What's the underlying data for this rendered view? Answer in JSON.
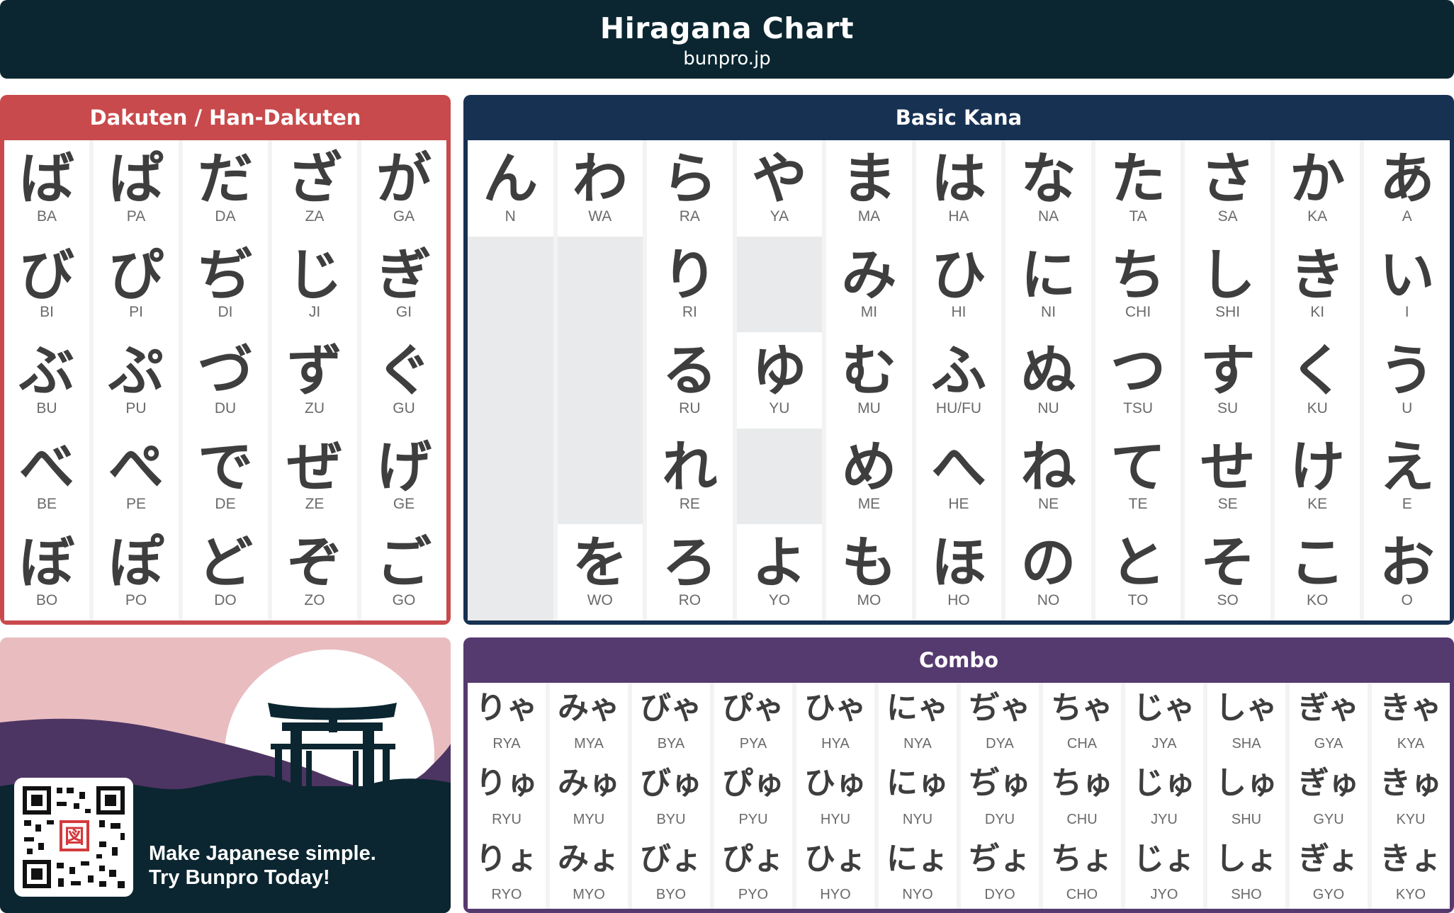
{
  "header": {
    "title": "Hiragana Chart",
    "subtitle": "bunpro.jp"
  },
  "colors": {
    "header": "#0b2630",
    "dakuten": "#c94a4c",
    "basic": "#173152",
    "combo": "#553a6f",
    "promo_bg": "#e9bcc0",
    "promo_hill": "#4d3563",
    "promo_ground": "#0b2630",
    "qr_accent": "#d3393c"
  },
  "dakuten": {
    "title": "Dakuten / Han-Dakuten",
    "cells": [
      {
        "kana": "ば",
        "romaji": "BA"
      },
      {
        "kana": "ぱ",
        "romaji": "PA"
      },
      {
        "kana": "だ",
        "romaji": "DA"
      },
      {
        "kana": "ざ",
        "romaji": "ZA"
      },
      {
        "kana": "が",
        "romaji": "GA"
      },
      {
        "kana": "び",
        "romaji": "BI"
      },
      {
        "kana": "ぴ",
        "romaji": "PI"
      },
      {
        "kana": "ぢ",
        "romaji": "DI"
      },
      {
        "kana": "じ",
        "romaji": "JI"
      },
      {
        "kana": "ぎ",
        "romaji": "GI"
      },
      {
        "kana": "ぶ",
        "romaji": "BU"
      },
      {
        "kana": "ぷ",
        "romaji": "PU"
      },
      {
        "kana": "づ",
        "romaji": "DU"
      },
      {
        "kana": "ず",
        "romaji": "ZU"
      },
      {
        "kana": "ぐ",
        "romaji": "GU"
      },
      {
        "kana": "べ",
        "romaji": "BE"
      },
      {
        "kana": "ぺ",
        "romaji": "PE"
      },
      {
        "kana": "で",
        "romaji": "DE"
      },
      {
        "kana": "ぜ",
        "romaji": "ZE"
      },
      {
        "kana": "げ",
        "romaji": "GE"
      },
      {
        "kana": "ぼ",
        "romaji": "BO"
      },
      {
        "kana": "ぽ",
        "romaji": "PO"
      },
      {
        "kana": "ど",
        "romaji": "DO"
      },
      {
        "kana": "ぞ",
        "romaji": "ZO"
      },
      {
        "kana": "ご",
        "romaji": "GO"
      }
    ]
  },
  "basic": {
    "title": "Basic Kana",
    "cells": [
      {
        "kana": "ん",
        "romaji": "N"
      },
      {
        "kana": "わ",
        "romaji": "WA"
      },
      {
        "kana": "ら",
        "romaji": "RA"
      },
      {
        "kana": "や",
        "romaji": "YA"
      },
      {
        "kana": "ま",
        "romaji": "MA"
      },
      {
        "kana": "は",
        "romaji": "HA"
      },
      {
        "kana": "な",
        "romaji": "NA"
      },
      {
        "kana": "た",
        "romaji": "TA"
      },
      {
        "kana": "さ",
        "romaji": "SA"
      },
      {
        "kana": "か",
        "romaji": "KA"
      },
      {
        "kana": "あ",
        "romaji": "A"
      },
      null,
      null,
      {
        "kana": "り",
        "romaji": "RI"
      },
      null,
      {
        "kana": "み",
        "romaji": "MI"
      },
      {
        "kana": "ひ",
        "romaji": "HI"
      },
      {
        "kana": "に",
        "romaji": "NI"
      },
      {
        "kana": "ち",
        "romaji": "CHI"
      },
      {
        "kana": "し",
        "romaji": "SHI"
      },
      {
        "kana": "き",
        "romaji": "KI"
      },
      {
        "kana": "い",
        "romaji": "I"
      },
      null,
      null,
      {
        "kana": "る",
        "romaji": "RU"
      },
      {
        "kana": "ゆ",
        "romaji": "YU"
      },
      {
        "kana": "む",
        "romaji": "MU"
      },
      {
        "kana": "ふ",
        "romaji": "HU/FU"
      },
      {
        "kana": "ぬ",
        "romaji": "NU"
      },
      {
        "kana": "つ",
        "romaji": "TSU"
      },
      {
        "kana": "す",
        "romaji": "SU"
      },
      {
        "kana": "く",
        "romaji": "KU"
      },
      {
        "kana": "う",
        "romaji": "U"
      },
      null,
      null,
      {
        "kana": "れ",
        "romaji": "RE"
      },
      null,
      {
        "kana": "め",
        "romaji": "ME"
      },
      {
        "kana": "へ",
        "romaji": "HE"
      },
      {
        "kana": "ね",
        "romaji": "NE"
      },
      {
        "kana": "て",
        "romaji": "TE"
      },
      {
        "kana": "せ",
        "romaji": "SE"
      },
      {
        "kana": "け",
        "romaji": "KE"
      },
      {
        "kana": "え",
        "romaji": "E"
      },
      null,
      {
        "kana": "を",
        "romaji": "WO"
      },
      {
        "kana": "ろ",
        "romaji": "RO"
      },
      {
        "kana": "よ",
        "romaji": "YO"
      },
      {
        "kana": "も",
        "romaji": "MO"
      },
      {
        "kana": "ほ",
        "romaji": "HO"
      },
      {
        "kana": "の",
        "romaji": "NO"
      },
      {
        "kana": "と",
        "romaji": "TO"
      },
      {
        "kana": "そ",
        "romaji": "SO"
      },
      {
        "kana": "こ",
        "romaji": "KO"
      },
      {
        "kana": "お",
        "romaji": "O"
      }
    ]
  },
  "combo": {
    "title": "Combo",
    "cells": [
      {
        "kana": "りゃ",
        "romaji": "RYA"
      },
      {
        "kana": "みゃ",
        "romaji": "MYA"
      },
      {
        "kana": "びゃ",
        "romaji": "BYA"
      },
      {
        "kana": "ぴゃ",
        "romaji": "PYA"
      },
      {
        "kana": "ひゃ",
        "romaji": "HYA"
      },
      {
        "kana": "にゃ",
        "romaji": "NYA"
      },
      {
        "kana": "ぢゃ",
        "romaji": "DYA"
      },
      {
        "kana": "ちゃ",
        "romaji": "CHA"
      },
      {
        "kana": "じゃ",
        "romaji": "JYA"
      },
      {
        "kana": "しゃ",
        "romaji": "SHA"
      },
      {
        "kana": "ぎゃ",
        "romaji": "GYA"
      },
      {
        "kana": "きゃ",
        "romaji": "KYA"
      },
      {
        "kana": "りゅ",
        "romaji": "RYU"
      },
      {
        "kana": "みゅ",
        "romaji": "MYU"
      },
      {
        "kana": "びゅ",
        "romaji": "BYU"
      },
      {
        "kana": "ぴゅ",
        "romaji": "PYU"
      },
      {
        "kana": "ひゅ",
        "romaji": "HYU"
      },
      {
        "kana": "にゅ",
        "romaji": "NYU"
      },
      {
        "kana": "ぢゅ",
        "romaji": "DYU"
      },
      {
        "kana": "ちゅ",
        "romaji": "CHU"
      },
      {
        "kana": "じゅ",
        "romaji": "JYU"
      },
      {
        "kana": "しゅ",
        "romaji": "SHU"
      },
      {
        "kana": "ぎゅ",
        "romaji": "GYU"
      },
      {
        "kana": "きゅ",
        "romaji": "KYU"
      },
      {
        "kana": "りょ",
        "romaji": "RYO"
      },
      {
        "kana": "みょ",
        "romaji": "MYO"
      },
      {
        "kana": "びょ",
        "romaji": "BYO"
      },
      {
        "kana": "ぴょ",
        "romaji": "PYO"
      },
      {
        "kana": "ひょ",
        "romaji": "HYO"
      },
      {
        "kana": "にょ",
        "romaji": "NYO"
      },
      {
        "kana": "ぢょ",
        "romaji": "DYO"
      },
      {
        "kana": "ちょ",
        "romaji": "CHO"
      },
      {
        "kana": "じょ",
        "romaji": "JYO"
      },
      {
        "kana": "しょ",
        "romaji": "SHO"
      },
      {
        "kana": "ぎょ",
        "romaji": "GYO"
      },
      {
        "kana": "きょ",
        "romaji": "KYO"
      }
    ]
  },
  "promo": {
    "line1": "Make Japanese simple.",
    "line2": "Try Bunpro Today!",
    "qr_logo_glyph": "図"
  }
}
